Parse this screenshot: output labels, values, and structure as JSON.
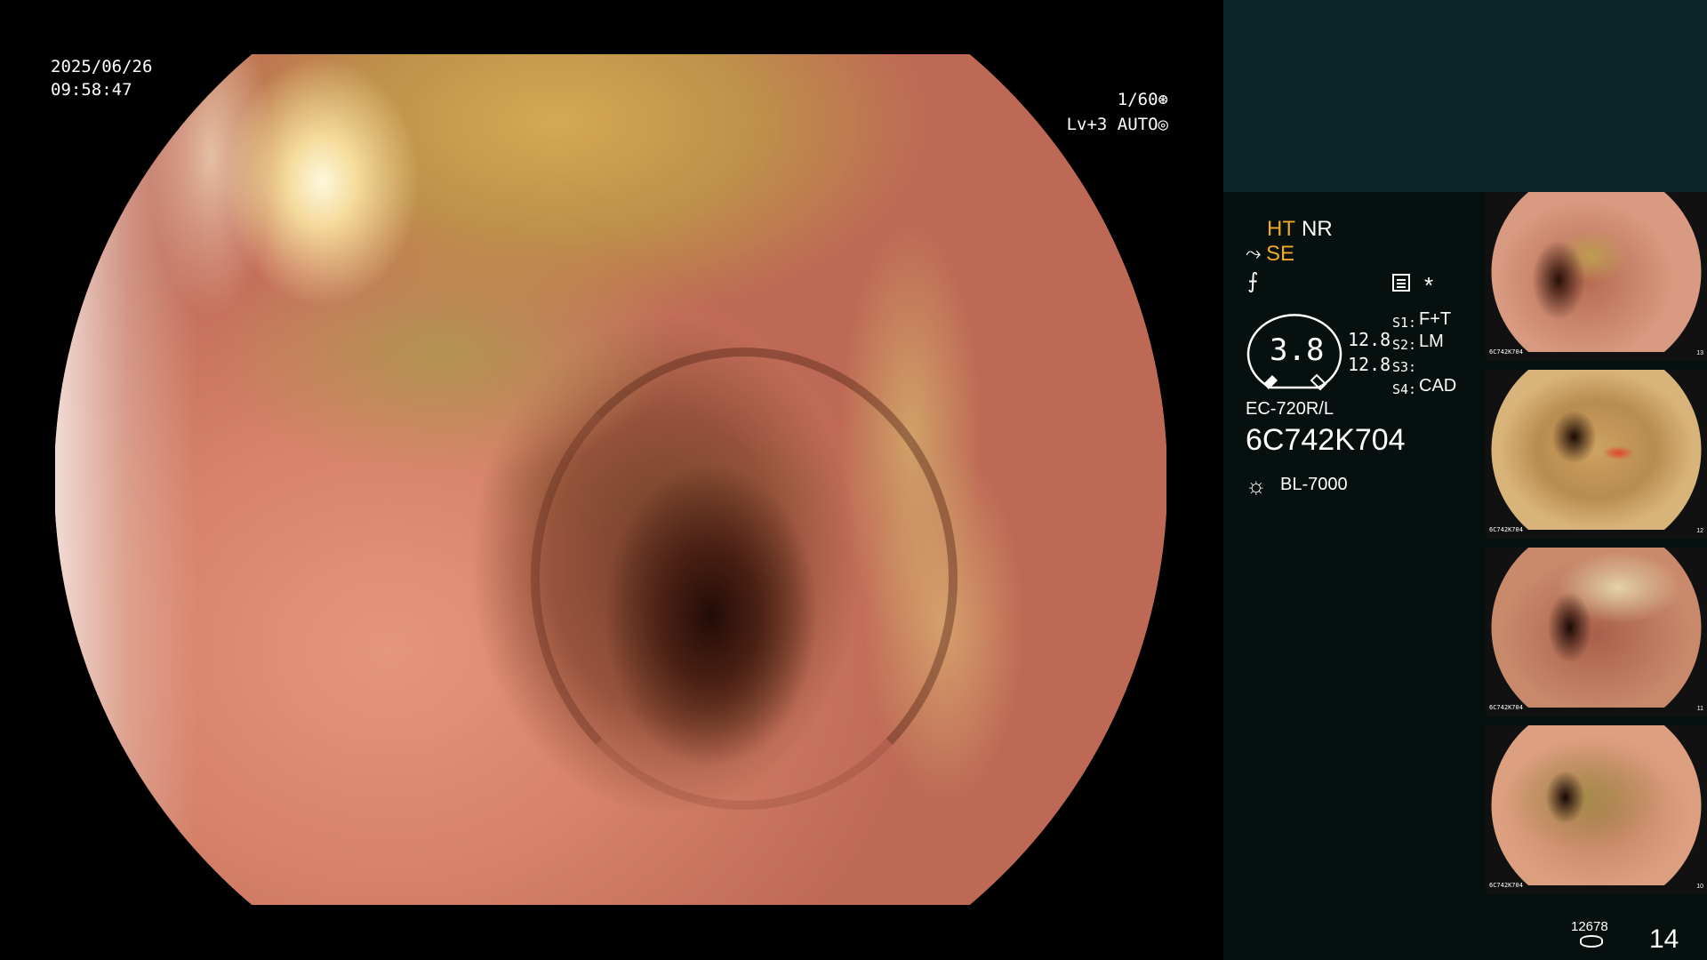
{
  "overlay": {
    "date": "2025/06/26",
    "time": "09:58:47",
    "shutter": "1/60⊛",
    "level": "Lv+3 AUTO◎"
  },
  "panel": {
    "ht": "HT",
    "nr": "NR",
    "se_icon": "⤳",
    "se": "SE",
    "enhance_icon": "⨍",
    "star": "*",
    "gauge_value": "3.8",
    "gauge_line1": "12.8",
    "gauge_line2": "12.8",
    "switches": [
      {
        "label": "S1:",
        "value": "F+T"
      },
      {
        "label": "S2:",
        "value": "LM"
      },
      {
        "label": "S3:",
        "value": ""
      },
      {
        "label": "S4:",
        "value": "CAD"
      }
    ],
    "scope_model": "EC-720R/L",
    "scope_serial": "6C742K704",
    "light_icon": "☼",
    "light_model": "BL-7000",
    "counter": "12678",
    "image_count": "14"
  },
  "thumbnails": [
    {
      "serial": "6C742K704",
      "num": "13"
    },
    {
      "serial": "6C742K704",
      "num": "12"
    },
    {
      "serial": "6C742K704",
      "num": "11"
    },
    {
      "serial": "6C742K704",
      "num": "10"
    }
  ],
  "colors": {
    "accent": "#f0a82a",
    "panel_bg": "#05100f",
    "panel_top_bg": "#0c2628"
  }
}
